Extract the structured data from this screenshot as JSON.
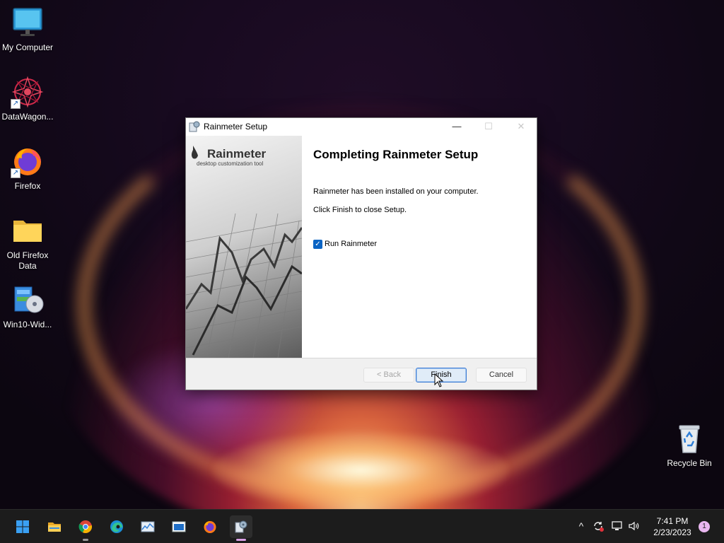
{
  "desktop": {
    "icons": [
      {
        "label": "My Computer",
        "icon": "monitor-icon"
      },
      {
        "label": "DataWagon...",
        "icon": "datawagon-icon"
      },
      {
        "label": "Firefox",
        "icon": "firefox-icon"
      },
      {
        "label": "Old Firefox Data",
        "icon": "folder-icon"
      },
      {
        "label": "Win10-Wid...",
        "icon": "installer-icon"
      },
      {
        "label": "Recycle Bin",
        "icon": "recycle-bin-icon"
      }
    ]
  },
  "dialog": {
    "title": "Rainmeter Setup",
    "brand_name": "Rainmeter",
    "brand_tagline": "desktop customization tool",
    "heading": "Completing Rainmeter Setup",
    "message1": "Rainmeter has been installed on your computer.",
    "message2": "Click Finish to close Setup.",
    "checkbox": {
      "label": "Run Rainmeter",
      "checked": true
    },
    "buttons": {
      "back": "< Back",
      "finish": "Finish",
      "cancel": "Cancel"
    },
    "titlebar_controls": {
      "minimize": "—",
      "maximize": "☐",
      "close": "✕"
    }
  },
  "taskbar": {
    "apps": [
      "start-icon",
      "file-explorer-icon",
      "chrome-icon",
      "edge-icon",
      "resource-monitor-icon",
      "app-window-icon",
      "firefox-icon",
      "rainmeter-setup-icon"
    ],
    "active_app": "rainmeter-setup-icon",
    "tray": {
      "chevron": "^",
      "time": "7:41 PM",
      "date": "2/23/2023",
      "notification_count": "1"
    }
  },
  "colors": {
    "accent": "#0a64c4",
    "taskbar": "#1c1c1c",
    "notification_badge": "#e9b7f0"
  }
}
